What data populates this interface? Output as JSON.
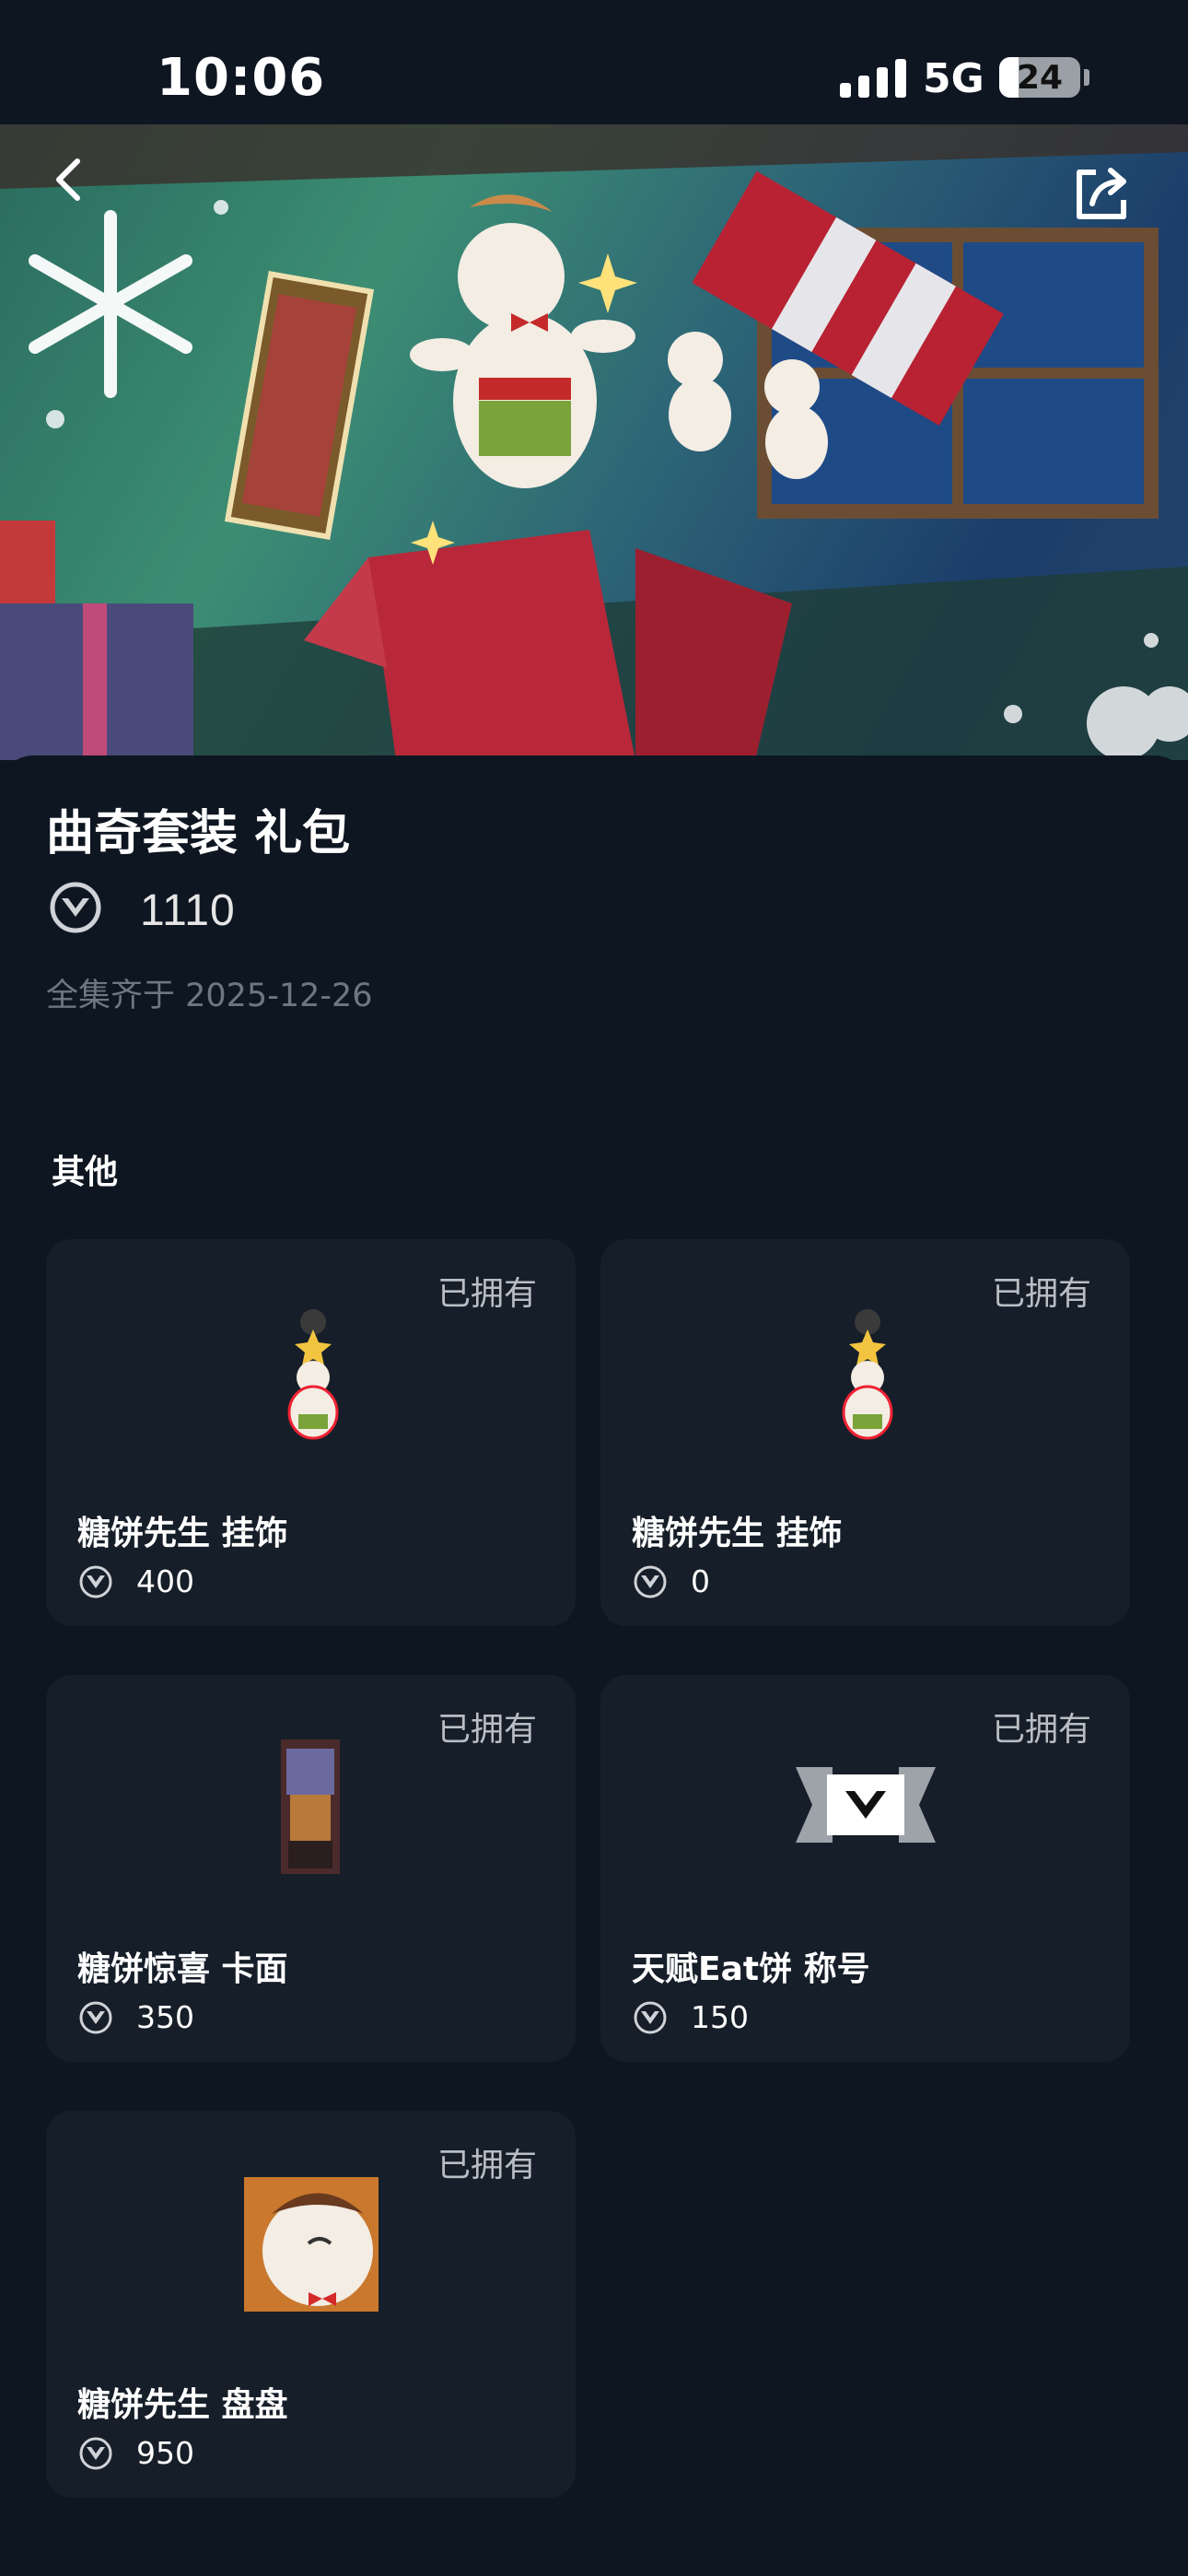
{
  "status_bar": {
    "time": "10:06",
    "network": "5G",
    "battery": "24",
    "battery_level_percent": 24
  },
  "bundle": {
    "title": "曲奇套装 礼包",
    "price": "1110",
    "date": "全集齐于 2025-12-26"
  },
  "section": {
    "label": "其他"
  },
  "items": [
    {
      "owned": "已拥有",
      "name": "糖饼先生 挂饰",
      "price": "400",
      "icon": "gingerbread-charm-icon"
    },
    {
      "owned": "已拥有",
      "name": "糖饼先生 挂饰",
      "price": "0",
      "icon": "gingerbread-charm-icon"
    },
    {
      "owned": "已拥有",
      "name": "糖饼惊喜 卡面",
      "price": "350",
      "icon": "player-card-icon"
    },
    {
      "owned": "已拥有",
      "name": "天赋Eat饼 称号",
      "price": "150",
      "icon": "title-badge-icon"
    },
    {
      "owned": "已拥有",
      "name": "糖饼先生 盘盘",
      "price": "950",
      "icon": "gingerbread-spray-icon"
    }
  ],
  "colors": {
    "background": "#0e1621",
    "card": "#161e29",
    "muted_text": "#6e7683",
    "owned_text": "#b9bec5"
  }
}
